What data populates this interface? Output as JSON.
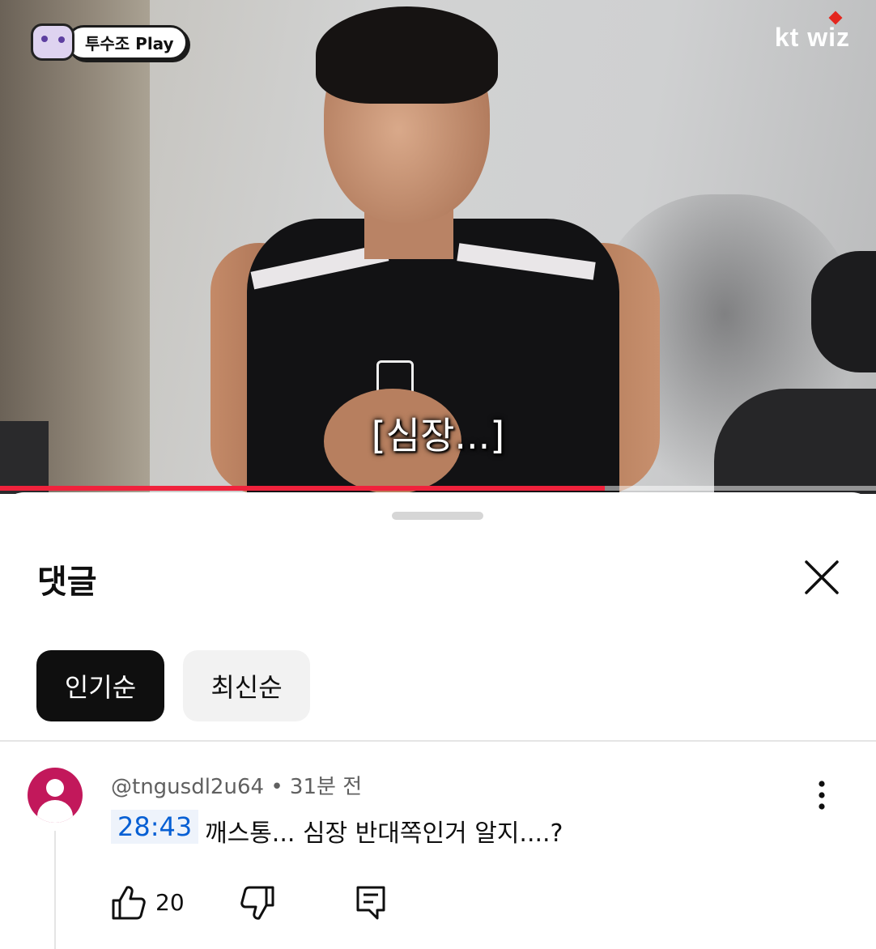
{
  "video": {
    "channel_badge": "투수조 Play",
    "brand": "kt wiz",
    "subtitle": "[심장...]",
    "progress": 0.69
  },
  "comments_panel": {
    "title": "댓글",
    "sort_chips": [
      {
        "label": "인기순",
        "selected": true
      },
      {
        "label": "최신순",
        "selected": false
      }
    ]
  },
  "comment": {
    "author": "@tngusdl2u64",
    "separator": "•",
    "time_ago": "31분 전",
    "timestamp": "28:43",
    "text": "깨스통... 심장 반대쪽인거 알지....?",
    "like_count": "20",
    "avatar_color": "#c2185b"
  },
  "colors": {
    "accent_red": "#f0223c",
    "link_blue": "#065fd4",
    "chip_selected": "#0f0f0f"
  }
}
